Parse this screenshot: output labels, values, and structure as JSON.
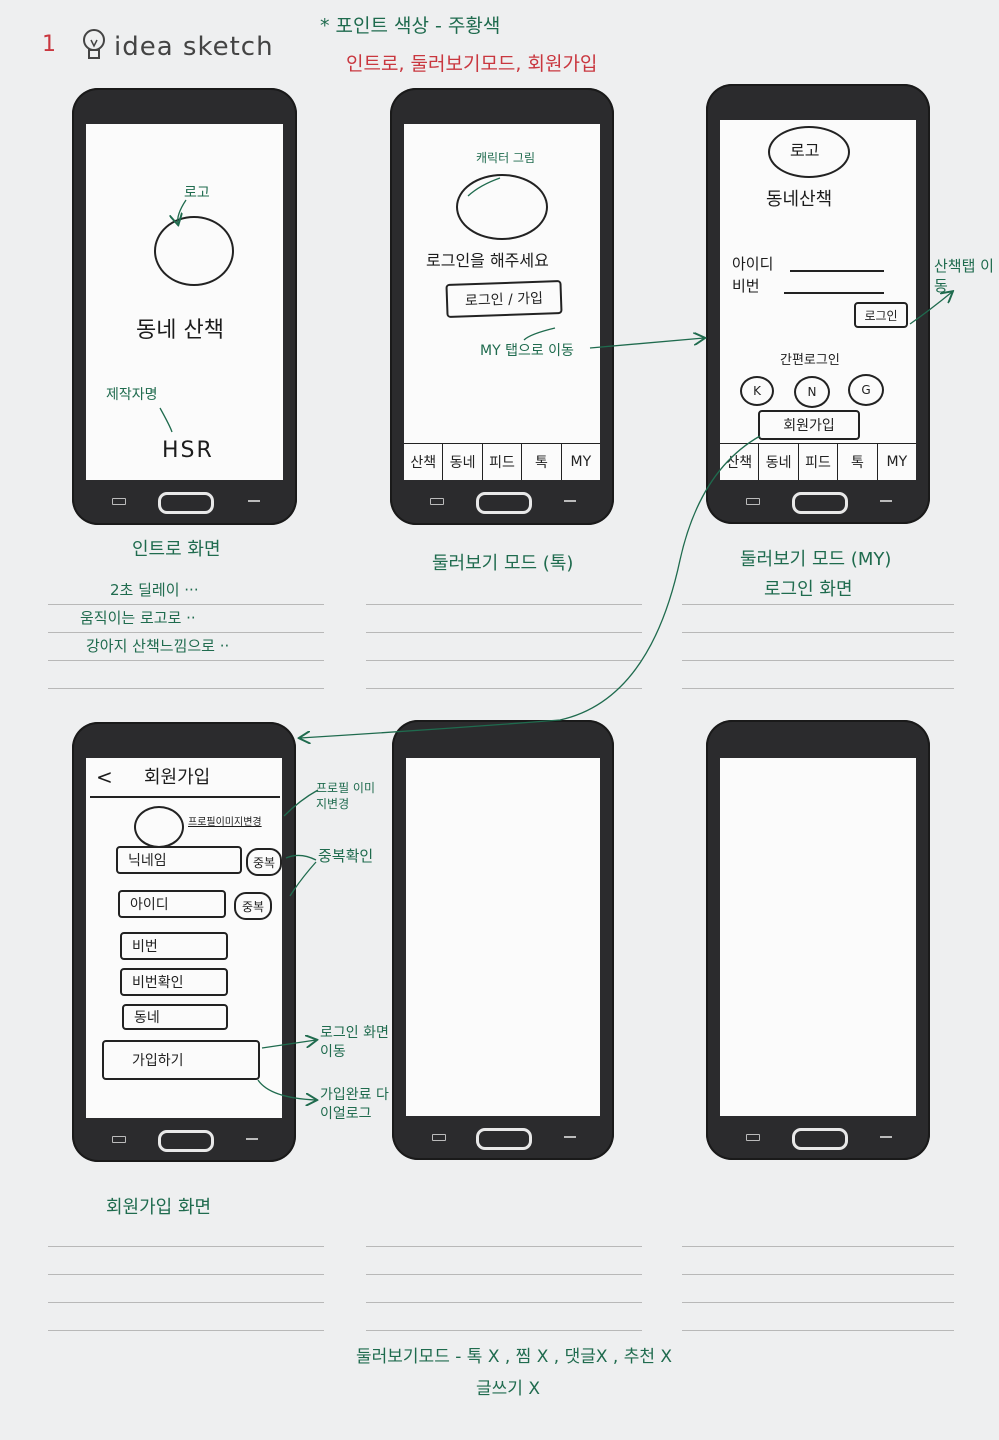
{
  "header": {
    "page_number": "1",
    "brand": "idea sketch",
    "point_color_note": "* 포인트 색상 - 주황색",
    "screens_note": "인트로, 둘러보기모드, 회원가입"
  },
  "screen1": {
    "logo_note": "로고",
    "app_name": "동네 산책",
    "author_note": "제작자명",
    "author": "HSR",
    "caption": "인트로 화면",
    "notes": [
      "2초 딜레이 ···",
      "움직이는 로고로 ··",
      "강아지 산책느낌으로 ··"
    ]
  },
  "screen2": {
    "character_note": "캐릭터 그림",
    "login_prompt": "로그인을 해주세요",
    "login_button": "로그인 / 가입",
    "move_note": "MY 탭으로 이동",
    "tabs": [
      "산책",
      "동네",
      "피드",
      "톡",
      "MY"
    ],
    "caption": "둘러보기 모드 (톡)"
  },
  "screen3": {
    "logo": "로고",
    "app_name": "동네산책",
    "id_label": "아이디",
    "pw_label": "비번",
    "login_button": "로그인",
    "side_note": "산책탭 이동",
    "simple_login": "간편로그인",
    "social": [
      "K",
      "N",
      "G"
    ],
    "signup_button": "회원가입",
    "tabs": [
      "산책",
      "동네",
      "피드",
      "톡",
      "MY"
    ],
    "caption_line1": "둘러보기 모드 (MY)",
    "caption_line2": "로그인 화면"
  },
  "screen4": {
    "back": "<",
    "title": "회원가입",
    "profile_change": "프로필이미지변경",
    "nickname": "닉네임",
    "id": "아이디",
    "dup_button": "중복",
    "password": "비번",
    "password_confirm": "비번확인",
    "neighborhood": "동네",
    "join_button": "가입하기",
    "note_profile": "프로필 이미지변경",
    "note_dup": "중복확인",
    "note_login_move": "로그인 화면이동",
    "note_complete": "가입완료 다이얼로그",
    "caption": "회원가입 화면"
  },
  "footer": {
    "line1": "둘러보기모드 - 톡 X , 찜 X , 댓글X , 추천 X",
    "line2": "글쓰기 X"
  }
}
